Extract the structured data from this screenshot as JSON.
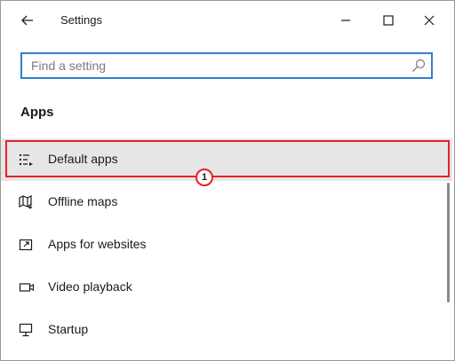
{
  "window": {
    "title": "Settings",
    "controls": [
      "minimize",
      "maximize",
      "close"
    ]
  },
  "search": {
    "placeholder": "Find a setting",
    "value": ""
  },
  "section": {
    "title": "Apps"
  },
  "nav": {
    "items": [
      {
        "label": "Default apps",
        "icon": "default-apps-icon",
        "selected": true
      },
      {
        "label": "Offline maps",
        "icon": "map-icon",
        "selected": false
      },
      {
        "label": "Apps for websites",
        "icon": "apps-for-websites-icon",
        "selected": false
      },
      {
        "label": "Video playback",
        "icon": "video-camera-icon",
        "selected": false
      },
      {
        "label": "Startup",
        "icon": "startup-monitor-icon",
        "selected": false
      }
    ]
  },
  "annotation": {
    "callout_number": "1",
    "highlight_color": "#e8202a"
  },
  "colors": {
    "accent": "#2f7fd1",
    "selected_bg": "#e6e6e6"
  }
}
